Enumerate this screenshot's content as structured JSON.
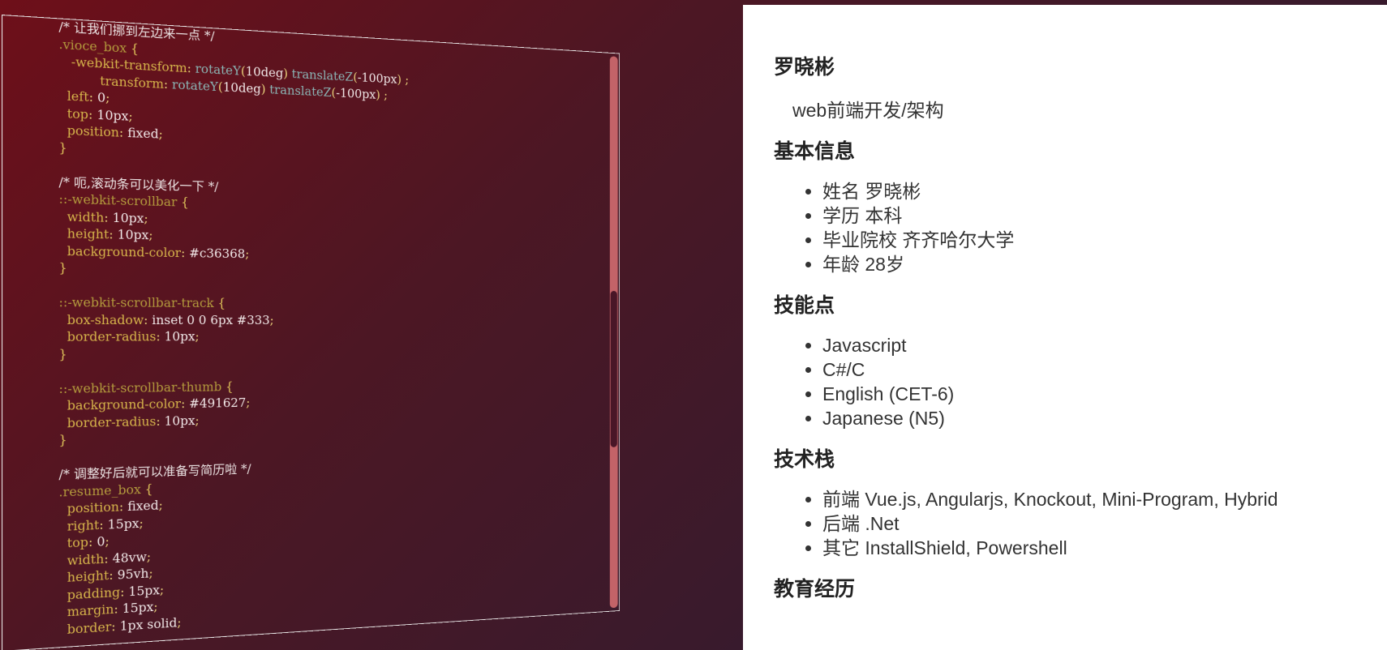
{
  "code_lines": [
    [
      [
        "tok-comment",
        "/* 让我们挪到左边来一点 */"
      ]
    ],
    [
      [
        "tok-sel",
        ".vioce_box "
      ],
      [
        "tok-brace",
        "{"
      ]
    ],
    [
      [
        "tok-prop",
        "   -webkit-transform"
      ],
      [
        "tok-punct",
        ": "
      ],
      [
        "tok-fn",
        "rotateY"
      ],
      [
        "tok-punct",
        "("
      ],
      [
        "tok-num",
        "10deg"
      ],
      [
        "tok-punct",
        ") "
      ],
      [
        "tok-fn",
        "translateZ"
      ],
      [
        "tok-punct",
        "("
      ],
      [
        "tok-num",
        "-100px"
      ],
      [
        "tok-punct",
        ") ;"
      ]
    ],
    [
      [
        "tok-prop",
        "          transform"
      ],
      [
        "tok-punct",
        ": "
      ],
      [
        "tok-fn",
        "rotateY"
      ],
      [
        "tok-punct",
        "("
      ],
      [
        "tok-num",
        "10deg"
      ],
      [
        "tok-punct",
        ") "
      ],
      [
        "tok-fn",
        "translateZ"
      ],
      [
        "tok-punct",
        "("
      ],
      [
        "tok-num",
        "-100px"
      ],
      [
        "tok-punct",
        ") ;"
      ]
    ],
    [
      [
        "tok-prop",
        "  left"
      ],
      [
        "tok-punct",
        ": "
      ],
      [
        "tok-val",
        "0"
      ],
      [
        "tok-punct",
        ";"
      ]
    ],
    [
      [
        "tok-prop",
        "  top"
      ],
      [
        "tok-punct",
        ": "
      ],
      [
        "tok-val",
        "10px"
      ],
      [
        "tok-punct",
        ";"
      ]
    ],
    [
      [
        "tok-prop",
        "  position"
      ],
      [
        "tok-punct",
        ": "
      ],
      [
        "tok-val",
        "fixed"
      ],
      [
        "tok-punct",
        ";"
      ]
    ],
    [
      [
        "tok-brace",
        "}"
      ]
    ],
    [
      [
        "tok-val",
        ""
      ]
    ],
    [
      [
        "tok-comment",
        "/* 呃,滚动条可以美化一下 */"
      ]
    ],
    [
      [
        "tok-sel",
        "::-webkit-scrollbar "
      ],
      [
        "tok-brace",
        "{"
      ]
    ],
    [
      [
        "tok-prop",
        "  width"
      ],
      [
        "tok-punct",
        ": "
      ],
      [
        "tok-val",
        "10px"
      ],
      [
        "tok-punct",
        ";"
      ]
    ],
    [
      [
        "tok-prop",
        "  height"
      ],
      [
        "tok-punct",
        ": "
      ],
      [
        "tok-val",
        "10px"
      ],
      [
        "tok-punct",
        ";"
      ]
    ],
    [
      [
        "tok-prop",
        "  background-color"
      ],
      [
        "tok-punct",
        ": "
      ],
      [
        "tok-val",
        "#c36368"
      ],
      [
        "tok-punct",
        ";"
      ]
    ],
    [
      [
        "tok-brace",
        "}"
      ]
    ],
    [
      [
        "tok-val",
        ""
      ]
    ],
    [
      [
        "tok-sel",
        "::-webkit-scrollbar-track "
      ],
      [
        "tok-brace",
        "{"
      ]
    ],
    [
      [
        "tok-prop",
        "  box-shadow"
      ],
      [
        "tok-punct",
        ": "
      ],
      [
        "tok-val",
        "inset 0 0 6px #333"
      ],
      [
        "tok-punct",
        ";"
      ]
    ],
    [
      [
        "tok-prop",
        "  border-radius"
      ],
      [
        "tok-punct",
        ": "
      ],
      [
        "tok-val",
        "10px"
      ],
      [
        "tok-punct",
        ";"
      ]
    ],
    [
      [
        "tok-brace",
        "}"
      ]
    ],
    [
      [
        "tok-val",
        ""
      ]
    ],
    [
      [
        "tok-sel",
        "::-webkit-scrollbar-thumb "
      ],
      [
        "tok-brace",
        "{"
      ]
    ],
    [
      [
        "tok-prop",
        "  background-color"
      ],
      [
        "tok-punct",
        ": "
      ],
      [
        "tok-val",
        "#491627"
      ],
      [
        "tok-punct",
        ";"
      ]
    ],
    [
      [
        "tok-prop",
        "  border-radius"
      ],
      [
        "tok-punct",
        ": "
      ],
      [
        "tok-val",
        "10px"
      ],
      [
        "tok-punct",
        ";"
      ]
    ],
    [
      [
        "tok-brace",
        "}"
      ]
    ],
    [
      [
        "tok-val",
        ""
      ]
    ],
    [
      [
        "tok-comment",
        "/* 调整好后就可以准备写简历啦 */"
      ]
    ],
    [
      [
        "tok-sel",
        ".resume_box "
      ],
      [
        "tok-brace",
        "{"
      ]
    ],
    [
      [
        "tok-prop",
        "  position"
      ],
      [
        "tok-punct",
        ": "
      ],
      [
        "tok-val",
        "fixed"
      ],
      [
        "tok-punct",
        ";"
      ]
    ],
    [
      [
        "tok-prop",
        "  right"
      ],
      [
        "tok-punct",
        ": "
      ],
      [
        "tok-val",
        "15px"
      ],
      [
        "tok-punct",
        ";"
      ]
    ],
    [
      [
        "tok-prop",
        "  top"
      ],
      [
        "tok-punct",
        ": "
      ],
      [
        "tok-val",
        "0"
      ],
      [
        "tok-punct",
        ";"
      ]
    ],
    [
      [
        "tok-prop",
        "  width"
      ],
      [
        "tok-punct",
        ": "
      ],
      [
        "tok-val",
        "48vw"
      ],
      [
        "tok-punct",
        ";"
      ]
    ],
    [
      [
        "tok-prop",
        "  height"
      ],
      [
        "tok-punct",
        ": "
      ],
      [
        "tok-val",
        "95vh"
      ],
      [
        "tok-punct",
        ";"
      ]
    ],
    [
      [
        "tok-prop",
        "  padding"
      ],
      [
        "tok-punct",
        ": "
      ],
      [
        "tok-val",
        "15px"
      ],
      [
        "tok-punct",
        ";"
      ]
    ],
    [
      [
        "tok-prop",
        "  margin"
      ],
      [
        "tok-punct",
        ": "
      ],
      [
        "tok-val",
        "15px"
      ],
      [
        "tok-punct",
        ";"
      ]
    ],
    [
      [
        "tok-prop",
        "  border"
      ],
      [
        "tok-punct",
        ": "
      ],
      [
        "tok-val",
        "1px solid"
      ],
      [
        "tok-punct",
        ";"
      ]
    ]
  ],
  "colors": {
    "scrollbar_track": "#c36368",
    "scrollbar_thumb": "#491627"
  },
  "resume": {
    "name": "罗晓彬",
    "title": "web前端开发/架构",
    "sections": [
      {
        "heading": "基本信息",
        "items": [
          "姓名 罗晓彬",
          "学历 本科",
          "毕业院校 齐齐哈尔大学",
          "年龄 28岁"
        ]
      },
      {
        "heading": "技能点",
        "items": [
          "Javascript",
          "C#/C",
          "English (CET-6)",
          "Japanese (N5)"
        ]
      },
      {
        "heading": "技术栈",
        "items": [
          "前端 Vue.js, Angularjs, Knockout, Mini-Program, Hybrid",
          "后端 .Net",
          "其它 InstallShield, Powershell"
        ]
      },
      {
        "heading": "教育经历",
        "items": []
      }
    ]
  }
}
